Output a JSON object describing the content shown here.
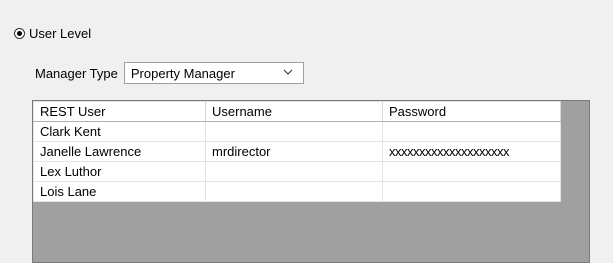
{
  "user_level": {
    "label": "User Level",
    "selected": true
  },
  "manager_type": {
    "label": "Manager Type",
    "selected_value": "Property Manager"
  },
  "grid": {
    "headers": [
      "REST User",
      "Username",
      "Password"
    ],
    "rows": [
      {
        "rest_user": "Clark Kent",
        "username": "",
        "password": ""
      },
      {
        "rest_user": "Janelle Lawrence",
        "username": "mrdirector",
        "password": "xxxxxxxxxxxxxxxxxxxx"
      },
      {
        "rest_user": "Lex Luthor",
        "username": "",
        "password": ""
      },
      {
        "rest_user": "Lois Lane",
        "username": "",
        "password": ""
      }
    ]
  }
}
